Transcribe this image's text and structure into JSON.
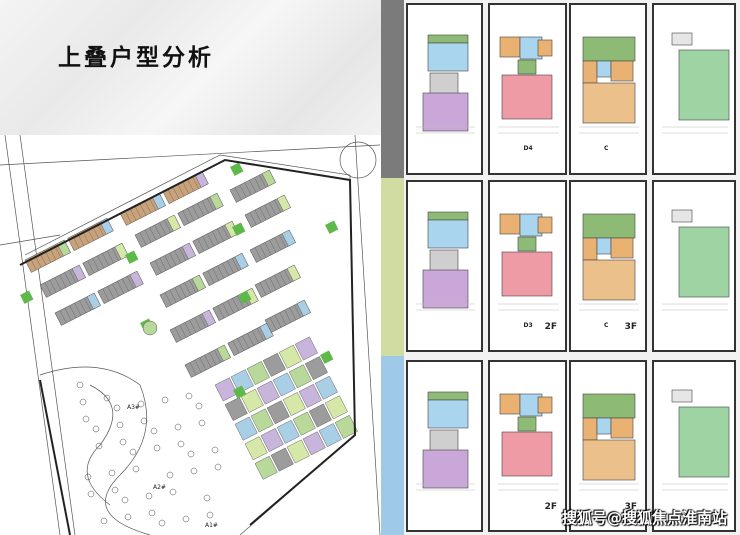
{
  "slide": {
    "title": "上叠户型分析",
    "watermark": "搜狐号@搜狐焦点淮南站"
  },
  "site_plan": {
    "building_labels": [
      "A3#",
      "A2#",
      "A1#"
    ]
  },
  "floor_plan_rows": [
    {
      "strip_color": "#7b7b7b",
      "panels": [
        {
          "type": "ground",
          "label": "",
          "floor": ""
        },
        {
          "type": "second",
          "label": "D4",
          "floor": ""
        },
        {
          "type": "third",
          "label": "C",
          "floor": ""
        },
        {
          "type": "roof",
          "label": "",
          "floor": ""
        }
      ]
    },
    {
      "strip_color": "#d0dca2",
      "panels": [
        {
          "type": "ground",
          "label": "",
          "floor": ""
        },
        {
          "type": "second",
          "label": "D3",
          "floor": "2F"
        },
        {
          "type": "third",
          "label": "C",
          "floor": "3F"
        },
        {
          "type": "roof",
          "label": "",
          "floor": ""
        }
      ]
    },
    {
      "strip_color": "#9ecae8",
      "panels": [
        {
          "type": "ground",
          "label": "",
          "floor": ""
        },
        {
          "type": "second",
          "label": "",
          "floor": "2F"
        },
        {
          "type": "third",
          "label": "",
          "floor": "3F"
        },
        {
          "type": "roof",
          "label": "",
          "floor": ""
        }
      ]
    }
  ]
}
